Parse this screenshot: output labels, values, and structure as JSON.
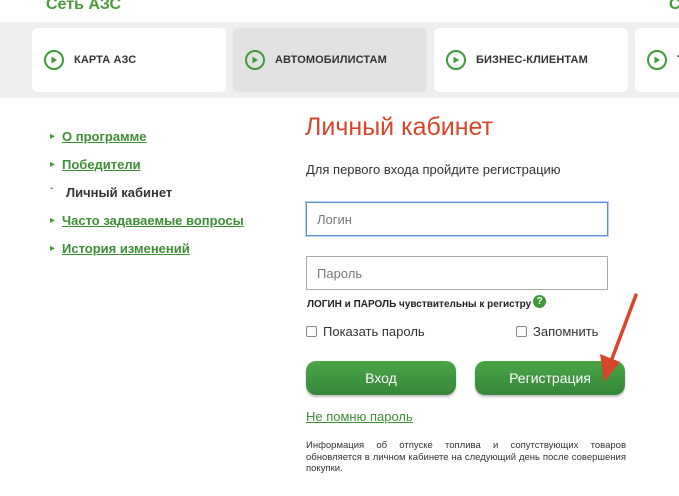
{
  "header": {
    "brand": "Сеть АЗС",
    "corner_char": "С"
  },
  "nav": {
    "tabs": [
      {
        "label": "КАРТА АЗС",
        "active": false
      },
      {
        "label": "АВТОМОБИЛИСТАМ",
        "active": true
      },
      {
        "label": "БИЗНЕС-КЛИЕНТАМ",
        "active": false
      },
      {
        "label": "Т",
        "active": false
      }
    ]
  },
  "sidebar": {
    "items": [
      {
        "label": "О программе",
        "current": false
      },
      {
        "label": "Победители",
        "current": false
      },
      {
        "label": "Личный кабинет",
        "current": true
      },
      {
        "label": "Часто задаваемые вопросы",
        "current": false
      },
      {
        "label": "История изменений",
        "current": false
      }
    ]
  },
  "main": {
    "title": "Личный кабинет",
    "subtitle": "Для первого входа пройдите регистрацию",
    "login_placeholder": "Логин",
    "password_placeholder": "Пароль",
    "case_hint": "ЛОГИН и ПАРОЛЬ чувствительны к регистру",
    "help_icon": "?",
    "show_password_label": "Показать пароль",
    "remember_label": "Запомнить",
    "login_button": "Вход",
    "register_button": "Регистрация",
    "forgot_link": "Не помню пароль",
    "info_text": "Информация об отпуске топлива и сопутствующих товаров обновляется в личном кабинете на следующий день после совершения покупки."
  },
  "colors": {
    "accent_green": "#3e9b3a",
    "title_red": "#d8452b",
    "arrow_red": "#d8452b"
  },
  "icons": {
    "nav_tab_icon": "circle-chevron-right-icon",
    "sidebar_bullet": "triangle-right-icon",
    "sidebar_current_bullet": "chevron-down-icon",
    "annotation": "red-arrow-icon"
  }
}
